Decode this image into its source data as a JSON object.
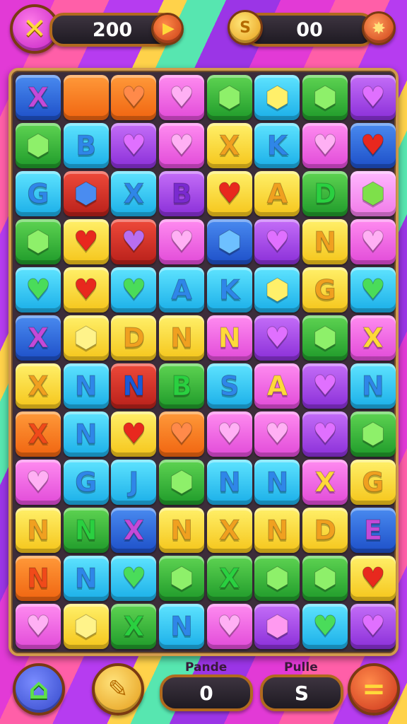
{
  "top": {
    "close_icon": "✕",
    "score": "200",
    "play_icon": "▶",
    "coin_symbol": "S",
    "coins": "00",
    "burst_icon": "✸"
  },
  "board": {
    "rows": [
      [
        {
          "c": "blue",
          "g": "X"
        },
        {
          "c": "orange",
          "g": ""
        },
        {
          "c": "orange",
          "g": "heart"
        },
        {
          "c": "pink",
          "g": "heart"
        },
        {
          "c": "green",
          "g": "gem"
        },
        {
          "c": "cyan",
          "g": "gem"
        },
        {
          "c": "green",
          "g": "gem"
        },
        {
          "c": "purple",
          "g": "heart"
        }
      ],
      [
        {
          "c": "green",
          "g": "gem"
        },
        {
          "c": "cyan",
          "g": "B"
        },
        {
          "c": "purple",
          "g": "heart"
        },
        {
          "c": "pink",
          "g": "heart"
        },
        {
          "c": "yellow",
          "g": "X"
        },
        {
          "c": "cyan",
          "g": "K"
        },
        {
          "c": "pink",
          "g": "heart"
        },
        {
          "c": "blue",
          "g": "heart"
        }
      ],
      [
        {
          "c": "cyan",
          "g": "G"
        },
        {
          "c": "red",
          "g": "gem"
        },
        {
          "c": "cyan",
          "g": "X"
        },
        {
          "c": "purple",
          "g": "B"
        },
        {
          "c": "yellow",
          "g": "heart"
        },
        {
          "c": "yellow",
          "g": "A"
        },
        {
          "c": "green",
          "g": "D"
        },
        {
          "c": "light",
          "g": "gem"
        }
      ],
      [
        {
          "c": "green",
          "g": "gem"
        },
        {
          "c": "yellow",
          "g": "heart"
        },
        {
          "c": "red",
          "g": "heart"
        },
        {
          "c": "pink",
          "g": "heart"
        },
        {
          "c": "blue",
          "g": "gem"
        },
        {
          "c": "purple",
          "g": "heart"
        },
        {
          "c": "yellow",
          "g": "N"
        },
        {
          "c": "pink",
          "g": "heart"
        }
      ],
      [
        {
          "c": "cyan",
          "g": "heart"
        },
        {
          "c": "yellow",
          "g": "heart"
        },
        {
          "c": "cyan",
          "g": "heart"
        },
        {
          "c": "cyan",
          "g": "A"
        },
        {
          "c": "cyan",
          "g": "K"
        },
        {
          "c": "cyan",
          "g": "gem"
        },
        {
          "c": "yellow",
          "g": "G"
        },
        {
          "c": "cyan",
          "g": "heart"
        }
      ],
      [
        {
          "c": "blue",
          "g": "X"
        },
        {
          "c": "yellow",
          "g": "gem"
        },
        {
          "c": "yellow",
          "g": "D"
        },
        {
          "c": "yellow",
          "g": "N"
        },
        {
          "c": "pink",
          "g": "N"
        },
        {
          "c": "purple",
          "g": "heart"
        },
        {
          "c": "green",
          "g": "gem"
        },
        {
          "c": "pink",
          "g": "X"
        }
      ],
      [
        {
          "c": "yellow",
          "g": "X"
        },
        {
          "c": "cyan",
          "g": "N"
        },
        {
          "c": "red",
          "g": "N"
        },
        {
          "c": "green",
          "g": "B"
        },
        {
          "c": "cyan",
          "g": "S"
        },
        {
          "c": "pink",
          "g": "A"
        },
        {
          "c": "purple",
          "g": "heart"
        },
        {
          "c": "cyan",
          "g": "N"
        }
      ],
      [
        {
          "c": "orange",
          "g": "X"
        },
        {
          "c": "cyan",
          "g": "N"
        },
        {
          "c": "yellow",
          "g": "heart"
        },
        {
          "c": "orange",
          "g": "heart"
        },
        {
          "c": "pink",
          "g": "heart"
        },
        {
          "c": "pink",
          "g": "heart"
        },
        {
          "c": "purple",
          "g": "heart"
        },
        {
          "c": "green",
          "g": "gem"
        }
      ],
      [
        {
          "c": "pink",
          "g": "heart"
        },
        {
          "c": "cyan",
          "g": "G"
        },
        {
          "c": "cyan",
          "g": "J"
        },
        {
          "c": "green",
          "g": "gem"
        },
        {
          "c": "cyan",
          "g": "N"
        },
        {
          "c": "cyan",
          "g": "N"
        },
        {
          "c": "pink",
          "g": "X"
        },
        {
          "c": "yellow",
          "g": "G"
        }
      ],
      [
        {
          "c": "yellow",
          "g": "N"
        },
        {
          "c": "green",
          "g": "N"
        },
        {
          "c": "blue",
          "g": "X"
        },
        {
          "c": "yellow",
          "g": "N"
        },
        {
          "c": "yellow",
          "g": "X"
        },
        {
          "c": "yellow",
          "g": "N"
        },
        {
          "c": "yellow",
          "g": "D"
        },
        {
          "c": "blue",
          "g": "E"
        }
      ],
      [
        {
          "c": "orange",
          "g": "N"
        },
        {
          "c": "cyan",
          "g": "N"
        },
        {
          "c": "cyan",
          "g": "heart"
        },
        {
          "c": "green",
          "g": "gem"
        },
        {
          "c": "green",
          "g": "X"
        },
        {
          "c": "green",
          "g": "gem"
        },
        {
          "c": "green",
          "g": "gem"
        },
        {
          "c": "yellow",
          "g": "heart"
        }
      ],
      [
        {
          "c": "pink",
          "g": "heart"
        },
        {
          "c": "yellow",
          "g": "gem"
        },
        {
          "c": "green",
          "g": "X"
        },
        {
          "c": "cyan",
          "g": "N"
        },
        {
          "c": "pink",
          "g": "heart"
        },
        {
          "c": "purple",
          "g": "gem"
        },
        {
          "c": "cyan",
          "g": "heart"
        },
        {
          "c": "purple",
          "g": "heart"
        }
      ]
    ]
  },
  "bottom": {
    "home_icon": "⌂",
    "hammer_icon": "✎",
    "stat1_label": "Pande",
    "stat1_value": "0",
    "stat2_label": "Pulle",
    "stat2_value": "S",
    "menu_icon": "="
  },
  "colors": {
    "blue": "#2a62dc",
    "orange": "#f47a1c",
    "green": "#32b43a",
    "pink": "#ec5ce0",
    "cyan": "#2cc4f2",
    "yellow": "#fadc34",
    "purple": "#a446e6",
    "red": "#d2302a",
    "light": "#f690ee",
    "letter_on_blue": "#c44ad8",
    "heart_red": "#e8281e"
  }
}
